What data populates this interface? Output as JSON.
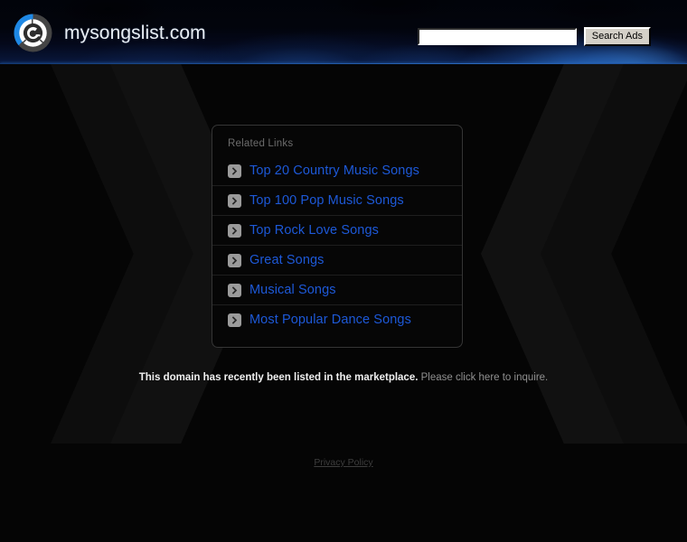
{
  "header": {
    "logo_icon": "circular-at-mark-logo",
    "brand_name": "mysongslist.com",
    "search": {
      "input_value": "",
      "input_placeholder": "",
      "button_label": "Search Ads"
    }
  },
  "related_links": {
    "title": "Related Links",
    "item_icon": "chevron-right-icon",
    "items": [
      {
        "label": "Top 20 Country Music Songs"
      },
      {
        "label": "Top 100 Pop Music Songs"
      },
      {
        "label": "Top Rock Love Songs"
      },
      {
        "label": "Great Songs"
      },
      {
        "label": "Musical Songs"
      },
      {
        "label": "Most Popular Dance Songs"
      }
    ]
  },
  "notice": {
    "headline": "This domain has recently been listed in the marketplace.",
    "subtext": " Please click here to inquire."
  },
  "footer": {
    "privacy_label": "Privacy Policy"
  },
  "colors": {
    "page_background": "#050505",
    "header_accent_line": "#1d4f96",
    "link_blue": "#1d59d8",
    "panel_border": "#353535",
    "badge_gray": "#9b9b9b",
    "muted_text": "#6c6c6c"
  }
}
